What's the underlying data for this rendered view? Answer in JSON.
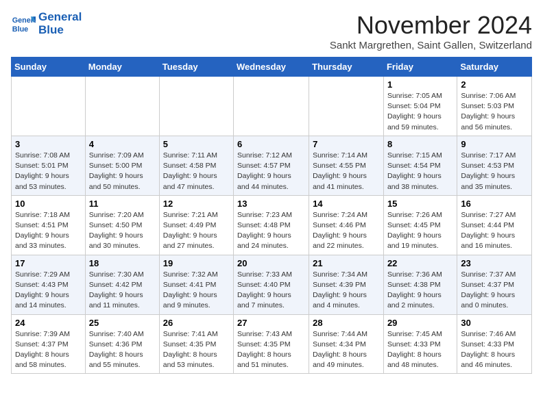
{
  "header": {
    "logo_line1": "General",
    "logo_line2": "Blue",
    "month": "November 2024",
    "location": "Sankt Margrethen, Saint Gallen, Switzerland"
  },
  "days_of_week": [
    "Sunday",
    "Monday",
    "Tuesday",
    "Wednesday",
    "Thursday",
    "Friday",
    "Saturday"
  ],
  "weeks": [
    [
      {
        "day": "",
        "info": ""
      },
      {
        "day": "",
        "info": ""
      },
      {
        "day": "",
        "info": ""
      },
      {
        "day": "",
        "info": ""
      },
      {
        "day": "",
        "info": ""
      },
      {
        "day": "1",
        "info": "Sunrise: 7:05 AM\nSunset: 5:04 PM\nDaylight: 9 hours and 59 minutes."
      },
      {
        "day": "2",
        "info": "Sunrise: 7:06 AM\nSunset: 5:03 PM\nDaylight: 9 hours and 56 minutes."
      }
    ],
    [
      {
        "day": "3",
        "info": "Sunrise: 7:08 AM\nSunset: 5:01 PM\nDaylight: 9 hours and 53 minutes."
      },
      {
        "day": "4",
        "info": "Sunrise: 7:09 AM\nSunset: 5:00 PM\nDaylight: 9 hours and 50 minutes."
      },
      {
        "day": "5",
        "info": "Sunrise: 7:11 AM\nSunset: 4:58 PM\nDaylight: 9 hours and 47 minutes."
      },
      {
        "day": "6",
        "info": "Sunrise: 7:12 AM\nSunset: 4:57 PM\nDaylight: 9 hours and 44 minutes."
      },
      {
        "day": "7",
        "info": "Sunrise: 7:14 AM\nSunset: 4:55 PM\nDaylight: 9 hours and 41 minutes."
      },
      {
        "day": "8",
        "info": "Sunrise: 7:15 AM\nSunset: 4:54 PM\nDaylight: 9 hours and 38 minutes."
      },
      {
        "day": "9",
        "info": "Sunrise: 7:17 AM\nSunset: 4:53 PM\nDaylight: 9 hours and 35 minutes."
      }
    ],
    [
      {
        "day": "10",
        "info": "Sunrise: 7:18 AM\nSunset: 4:51 PM\nDaylight: 9 hours and 33 minutes."
      },
      {
        "day": "11",
        "info": "Sunrise: 7:20 AM\nSunset: 4:50 PM\nDaylight: 9 hours and 30 minutes."
      },
      {
        "day": "12",
        "info": "Sunrise: 7:21 AM\nSunset: 4:49 PM\nDaylight: 9 hours and 27 minutes."
      },
      {
        "day": "13",
        "info": "Sunrise: 7:23 AM\nSunset: 4:48 PM\nDaylight: 9 hours and 24 minutes."
      },
      {
        "day": "14",
        "info": "Sunrise: 7:24 AM\nSunset: 4:46 PM\nDaylight: 9 hours and 22 minutes."
      },
      {
        "day": "15",
        "info": "Sunrise: 7:26 AM\nSunset: 4:45 PM\nDaylight: 9 hours and 19 minutes."
      },
      {
        "day": "16",
        "info": "Sunrise: 7:27 AM\nSunset: 4:44 PM\nDaylight: 9 hours and 16 minutes."
      }
    ],
    [
      {
        "day": "17",
        "info": "Sunrise: 7:29 AM\nSunset: 4:43 PM\nDaylight: 9 hours and 14 minutes."
      },
      {
        "day": "18",
        "info": "Sunrise: 7:30 AM\nSunset: 4:42 PM\nDaylight: 9 hours and 11 minutes."
      },
      {
        "day": "19",
        "info": "Sunrise: 7:32 AM\nSunset: 4:41 PM\nDaylight: 9 hours and 9 minutes."
      },
      {
        "day": "20",
        "info": "Sunrise: 7:33 AM\nSunset: 4:40 PM\nDaylight: 9 hours and 7 minutes."
      },
      {
        "day": "21",
        "info": "Sunrise: 7:34 AM\nSunset: 4:39 PM\nDaylight: 9 hours and 4 minutes."
      },
      {
        "day": "22",
        "info": "Sunrise: 7:36 AM\nSunset: 4:38 PM\nDaylight: 9 hours and 2 minutes."
      },
      {
        "day": "23",
        "info": "Sunrise: 7:37 AM\nSunset: 4:37 PM\nDaylight: 9 hours and 0 minutes."
      }
    ],
    [
      {
        "day": "24",
        "info": "Sunrise: 7:39 AM\nSunset: 4:37 PM\nDaylight: 8 hours and 58 minutes."
      },
      {
        "day": "25",
        "info": "Sunrise: 7:40 AM\nSunset: 4:36 PM\nDaylight: 8 hours and 55 minutes."
      },
      {
        "day": "26",
        "info": "Sunrise: 7:41 AM\nSunset: 4:35 PM\nDaylight: 8 hours and 53 minutes."
      },
      {
        "day": "27",
        "info": "Sunrise: 7:43 AM\nSunset: 4:35 PM\nDaylight: 8 hours and 51 minutes."
      },
      {
        "day": "28",
        "info": "Sunrise: 7:44 AM\nSunset: 4:34 PM\nDaylight: 8 hours and 49 minutes."
      },
      {
        "day": "29",
        "info": "Sunrise: 7:45 AM\nSunset: 4:33 PM\nDaylight: 8 hours and 48 minutes."
      },
      {
        "day": "30",
        "info": "Sunrise: 7:46 AM\nSunset: 4:33 PM\nDaylight: 8 hours and 46 minutes."
      }
    ]
  ]
}
